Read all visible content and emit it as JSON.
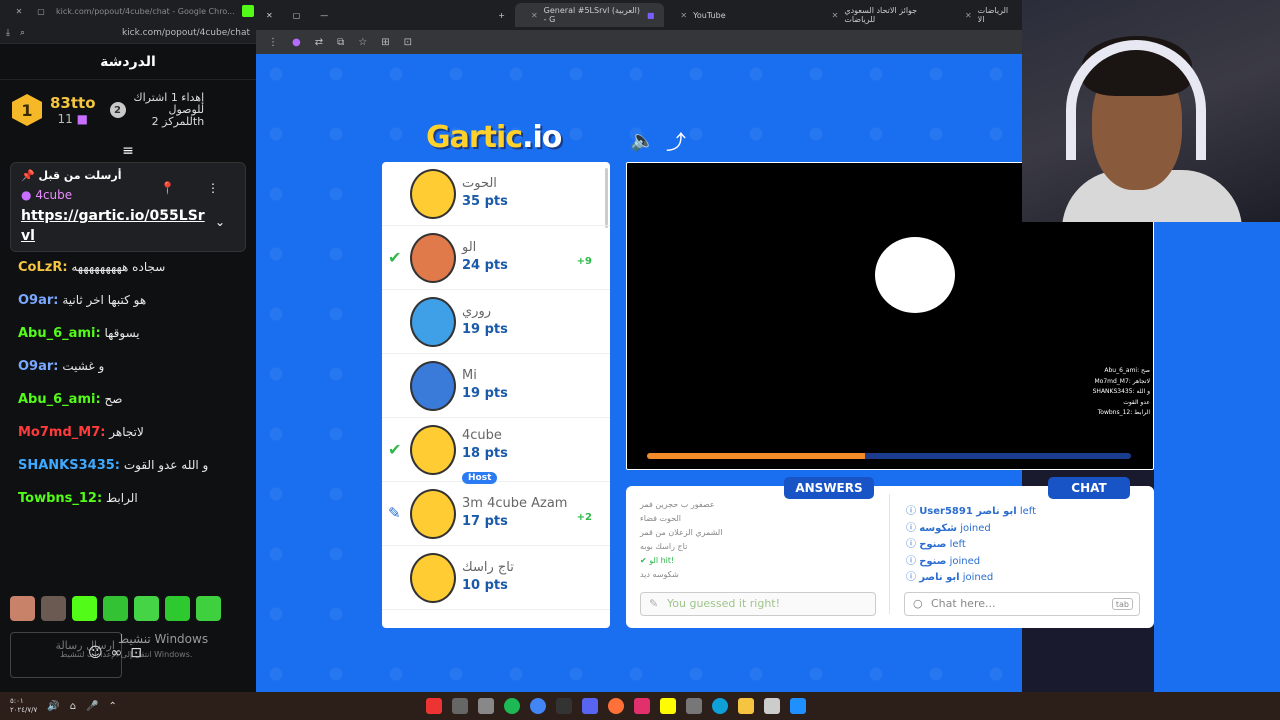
{
  "kick": {
    "window_url": "kick.com/popout/4cube/chat - Google Chro...",
    "address": "kick.com/popout/4cube/chat",
    "title": "الدردشة",
    "leader1": {
      "rank": "1",
      "name": "83tto",
      "count": "11"
    },
    "leader2": {
      "rank": "2",
      "text_line1": "إهداء 1 اشتراك",
      "text_line2": "للوصول",
      "text_line3": "للمركز 2th"
    },
    "pinned": {
      "title": "أرسلت من قبل",
      "user": "4cube",
      "link": "https://gartic.io/055LSrvl"
    },
    "messages": [
      {
        "user": "CoLzR:",
        "text": "سجاده هههههههههه",
        "color": "#f5c542"
      },
      {
        "user": "O9ar:",
        "text": "هو كتبها اخر ثانية",
        "color": "#7aa8ff"
      },
      {
        "user": "Abu_6_ami:",
        "text": "يسوقها",
        "color": "#53fc18"
      },
      {
        "user": "O9ar:",
        "text": "و غشيت",
        "color": "#7aa8ff"
      },
      {
        "user": "Abu_6_ami:",
        "text": "صح",
        "color": "#53fc18"
      },
      {
        "user": "Mo7md_M7:",
        "text": "لاتجاهر",
        "color": "#ff3b3b"
      },
      {
        "user": "SHANKS3435:",
        "text": "و الله عدو القوت",
        "color": "#3fa9ff"
      },
      {
        "user": "Towbns_12:",
        "text": "الرابط",
        "color": "#53fc18"
      }
    ],
    "input_placeholder": "ارسال رسالة",
    "watermark1": "تنشيط Windows",
    "watermark2": "انتقل إلى الإعدادات لتنشيط Windows."
  },
  "browser": {
    "tabs": [
      {
        "label": "General #5LSrvl (العربية) - G"
      },
      {
        "label": "YouTube"
      },
      {
        "label": "جوائز الاتحاد السعودي للرياضات"
      },
      {
        "label": "الرياضات الا"
      }
    ]
  },
  "game": {
    "logo_main": "Gartic",
    "logo_io": ".io",
    "players": [
      {
        "name": "الحوت",
        "pts": "35 pts",
        "status": "",
        "bonus": "",
        "host": "",
        "color": "#ffcc33"
      },
      {
        "name": "الو",
        "pts": "24 pts",
        "status": "check",
        "bonus": "+9",
        "host": "",
        "color": "#e07a4a"
      },
      {
        "name": "روري",
        "pts": "19 pts",
        "status": "",
        "bonus": "",
        "host": "",
        "color": "#3fa0e8"
      },
      {
        "name": "Mi",
        "pts": "19 pts",
        "status": "",
        "bonus": "",
        "host": "",
        "color": "#3a7ad8"
      },
      {
        "name": "4cube",
        "pts": "18 pts",
        "status": "check",
        "bonus": "",
        "host": "Host",
        "color": "#ffcc33"
      },
      {
        "name": "3m 4cube Azam",
        "pts": "17 pts",
        "status": "pen",
        "bonus": "+2",
        "host": "",
        "color": "#ffcc33"
      },
      {
        "name": "تاج راسك",
        "pts": "10 pts",
        "status": "",
        "bonus": "",
        "host": "",
        "color": "#ffcc33"
      }
    ],
    "timer_progress": 0.45,
    "answers_label": "ANSWERS",
    "chat_label": "CHAT",
    "answers": [
      {
        "text": "عصفور ب حجرين فمر",
        "hit": false
      },
      {
        "text": "الحوت فضاء",
        "hit": false
      },
      {
        "text": "الشمري الزعلان من قمر",
        "hit": false
      },
      {
        "text": "تاج راسك بوبه",
        "hit": false
      },
      {
        "text": "الو hit!",
        "hit": true
      },
      {
        "text": "شكوسه ديد",
        "hit": false
      }
    ],
    "answer_input": "You guessed it right!",
    "chat_log": [
      {
        "name": "User5891 ابو ناصر",
        "action": "left"
      },
      {
        "name": "شكوسه",
        "action": "joined"
      },
      {
        "name": "صنوح",
        "action": "left"
      },
      {
        "name": "صنوح",
        "action": "joined"
      },
      {
        "name": "ابو ناصر",
        "action": "joined"
      }
    ],
    "chat_placeholder": "Chat here...",
    "chat_tab_hint": "tab"
  },
  "overlay_chat": [
    "Abu_6_ami: صح",
    "Mo7md_M7: لاتجاهر",
    "SHANKS3435: و الله عدو القوت",
    "Towbns_12: الرابط"
  ],
  "taskbar": {
    "time": "٥:٠١",
    "date": "٢٠٢٤/٧/٧"
  }
}
